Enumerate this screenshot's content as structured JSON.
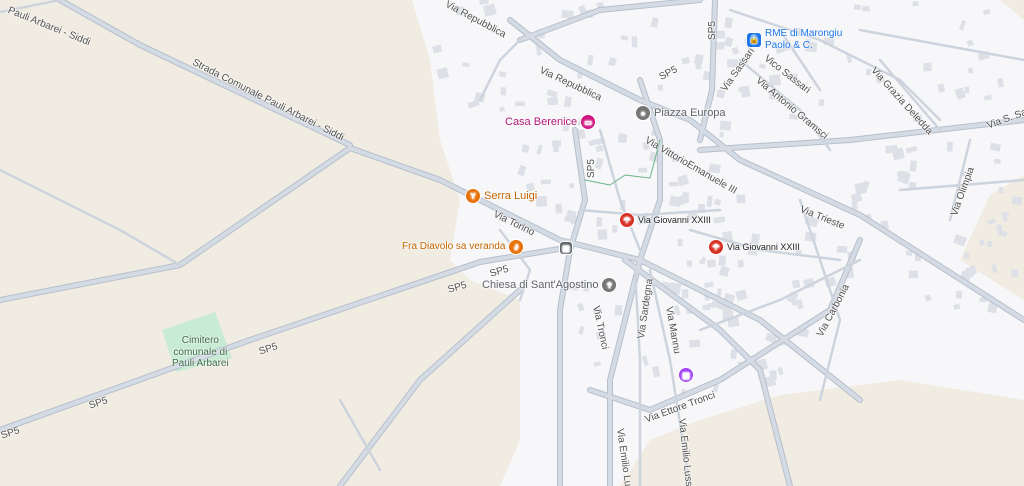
{
  "colors": {
    "land": "#f1ece2",
    "urban": "#f7f7f9",
    "road": "#c9d1dc",
    "road_casing": "#b2bcc9",
    "building": "#dde0e6",
    "park": "#c8ebd4",
    "orange": "#e8710a",
    "pink": "#d01884",
    "red": "#d93025",
    "blue": "#1a73e8",
    "gray": "#757575",
    "purple": "#a142f4"
  },
  "roads": [
    {
      "id": "pauli-arbarei-siddi",
      "text": "Pauli Arbarei - Siddi"
    },
    {
      "id": "strada-comunale",
      "text": "Strada Comunale Pauli Arbarei - Siddi"
    },
    {
      "id": "via-repubblica-top",
      "text": "Via Repubblica"
    },
    {
      "id": "via-repubblica",
      "text": "Via Repubblica"
    },
    {
      "id": "sp5-a",
      "text": "SP5"
    },
    {
      "id": "sp5-b",
      "text": "SP5"
    },
    {
      "id": "sp5-c",
      "text": "SP5"
    },
    {
      "id": "sp5-d",
      "text": "SP5"
    },
    {
      "id": "sp5-e",
      "text": "SP5"
    },
    {
      "id": "sp5-f",
      "text": "SP5"
    },
    {
      "id": "sp5-g",
      "text": "SP5"
    },
    {
      "id": "sp5-h",
      "text": "SP5"
    },
    {
      "id": "via-sassari",
      "text": "Via Sassari"
    },
    {
      "id": "vico-sassari",
      "text": "Vico Sassari"
    },
    {
      "id": "via-antonio-gramsci",
      "text": "Via Antonio Gramsci"
    },
    {
      "id": "via-grazia-deledda",
      "text": "Via Grazia Deledda"
    },
    {
      "id": "via-s-sa",
      "text": "Via S. Sa"
    },
    {
      "id": "via-vittorio-emanuele",
      "text": "Via VittorioEmanuele III"
    },
    {
      "id": "via-trieste",
      "text": "Via Trieste"
    },
    {
      "id": "via-olimpia",
      "text": "Via Olimpia"
    },
    {
      "id": "via-torino",
      "text": "Via Torino"
    },
    {
      "id": "via-carbonia",
      "text": "Via Carbonia"
    },
    {
      "id": "via-tronci",
      "text": "Via Tronci"
    },
    {
      "id": "via-sardegna",
      "text": "Via Sardegna"
    },
    {
      "id": "via-mannu",
      "text": "Via Mannu"
    },
    {
      "id": "via-ettore-tronci",
      "text": "Via Ettore Tronci"
    },
    {
      "id": "via-emilio-lussu-1",
      "text": "Via Emilio Lussu"
    },
    {
      "id": "via-emilio-lussu-2",
      "text": "Via Emilio Lussu"
    }
  ],
  "pois": [
    {
      "id": "rme",
      "name": "RME di Marongiu\nPaolo & C.",
      "icon": "lock-icon",
      "glyph": "🔒",
      "color": "#1a73e8",
      "text_color": "#1a73e8"
    },
    {
      "id": "piazza-europa",
      "name": "Piazza Europa",
      "icon": "pin-icon",
      "glyph": "●",
      "color": "#757575",
      "text_color": "#5f6368"
    },
    {
      "id": "casa-berenice",
      "name": "Casa Berenice",
      "icon": "bed-icon",
      "glyph": "▭",
      "color": "#d01884",
      "text_color": "#b0197a"
    },
    {
      "id": "serra-luigi",
      "name": "Serra Luigi",
      "icon": "cocktail-icon",
      "glyph": "Y",
      "color": "#e8710a",
      "text_color": "#c26401"
    },
    {
      "id": "fra-diavolo",
      "name": "Fra Diavolo sa veranda",
      "icon": "restaurant-icon",
      "glyph": "⑂",
      "color": "#e8710a",
      "text_color": "#c26401"
    },
    {
      "id": "via-giovanni-1",
      "name": "Via Giovanni XXIII",
      "icon": "umbrella-icon",
      "glyph": "☂",
      "color": "#d93025",
      "text_color": "#202124"
    },
    {
      "id": "via-giovanni-2",
      "name": "Via Giovanni XXIII",
      "icon": "umbrella-icon",
      "glyph": "☂",
      "color": "#d93025",
      "text_color": "#202124"
    },
    {
      "id": "chiesa",
      "name": "Chiesa di Sant'Agostino",
      "icon": "church-icon",
      "glyph": "✝",
      "color": "#757575",
      "text_color": "#5f6368"
    },
    {
      "id": "museum",
      "name": "",
      "icon": "museum-icon",
      "glyph": "▥",
      "color": "#a142f4",
      "text_color": "#a142f4"
    },
    {
      "id": "bus",
      "name": "",
      "icon": "bus-stop-icon",
      "glyph": "▣",
      "color": "#5f6368",
      "text_color": "#5f6368"
    }
  ],
  "areas": [
    {
      "id": "cimitero",
      "name": "Cimitero\ncomunale di\nPauli Arbarei"
    }
  ]
}
